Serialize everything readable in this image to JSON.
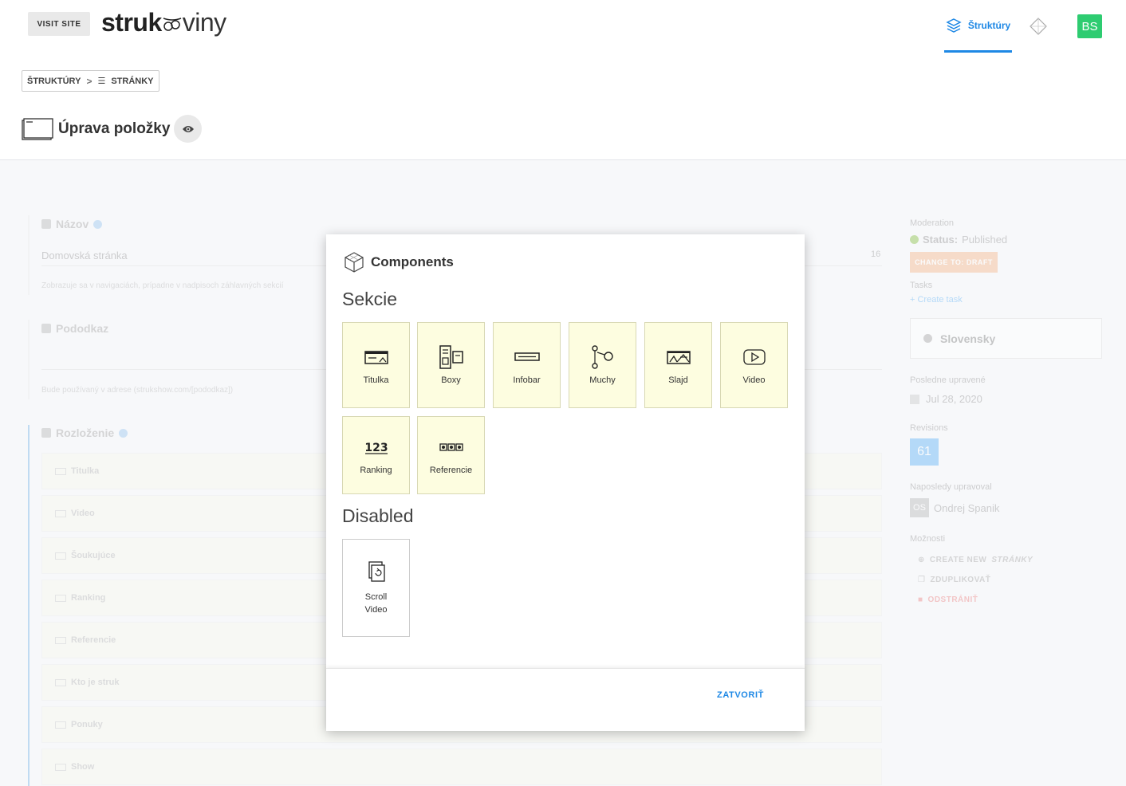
{
  "topbar": {
    "visit_label": "VISIT SITE",
    "logo_bold": "struk",
    "logo_light": "viny",
    "nav_struct_label": "Štruktúry",
    "avatar": "BS"
  },
  "breadcrumb": {
    "item1": "ŠTRUKTÚRY",
    "separator": ">",
    "item2": "STRÁNKY"
  },
  "page": {
    "title": "Úprava položky"
  },
  "form": {
    "name_label": "Názov",
    "name_value": "Domovská stránka",
    "name_count": "16",
    "name_hint": "Zobrazuje sa v navigaciách, prípadne v nadpisoch záhlavných sekcií",
    "slug_label": "Pododkaz",
    "slug_hint": "Bude používaný v adrese (strukshow.com/[pododkaz])",
    "layout_label": "Rozloženie",
    "layout_rows": [
      "Titulka",
      "Video",
      "Šoukujúce",
      "Ranking",
      "Referencie",
      "Kto je struk",
      "Ponuky",
      "Show"
    ]
  },
  "sidebar": {
    "moderation_label": "Moderation",
    "status_label": "Status:",
    "status_value": "Published",
    "change_to_label": "CHANGE TO:",
    "change_to_value": "DRAFT",
    "tasks_label": "Tasks",
    "create_task": "+ Create task",
    "language": "Slovensky",
    "updated_label": "Posledne upravené",
    "updated_value": "Jul 28, 2020",
    "revisions_label": "Revisions",
    "revisions_value": "61",
    "last_editor_label": "Naposledy upravoval",
    "last_editor_initials": "OS",
    "last_editor_name": "Ondrej Spanik",
    "options_label": "Možnosti",
    "opt_create_prefix": "CREATE NEW",
    "opt_create_suffix": "STRÁNKY",
    "opt_duplicate": "ZDUPLIKOVAŤ",
    "opt_delete": "ODSTRÁNIŤ"
  },
  "modal": {
    "title": "Components",
    "section_sekcie": "Sekcie",
    "section_disabled": "Disabled",
    "sekcie_tiles": [
      "Titulka",
      "Boxy",
      "Infobar",
      "Muchy",
      "Slajd",
      "Video",
      "Ranking",
      "Referencie"
    ],
    "disabled_tiles": [
      "Scroll Video"
    ],
    "close_label": "ZATVORIŤ"
  },
  "colors": {
    "accent": "#1e88e5",
    "avatar_bg": "#2ecc71",
    "tile_bg": "#fdfde0",
    "draft_btn": "#f5b98f"
  }
}
